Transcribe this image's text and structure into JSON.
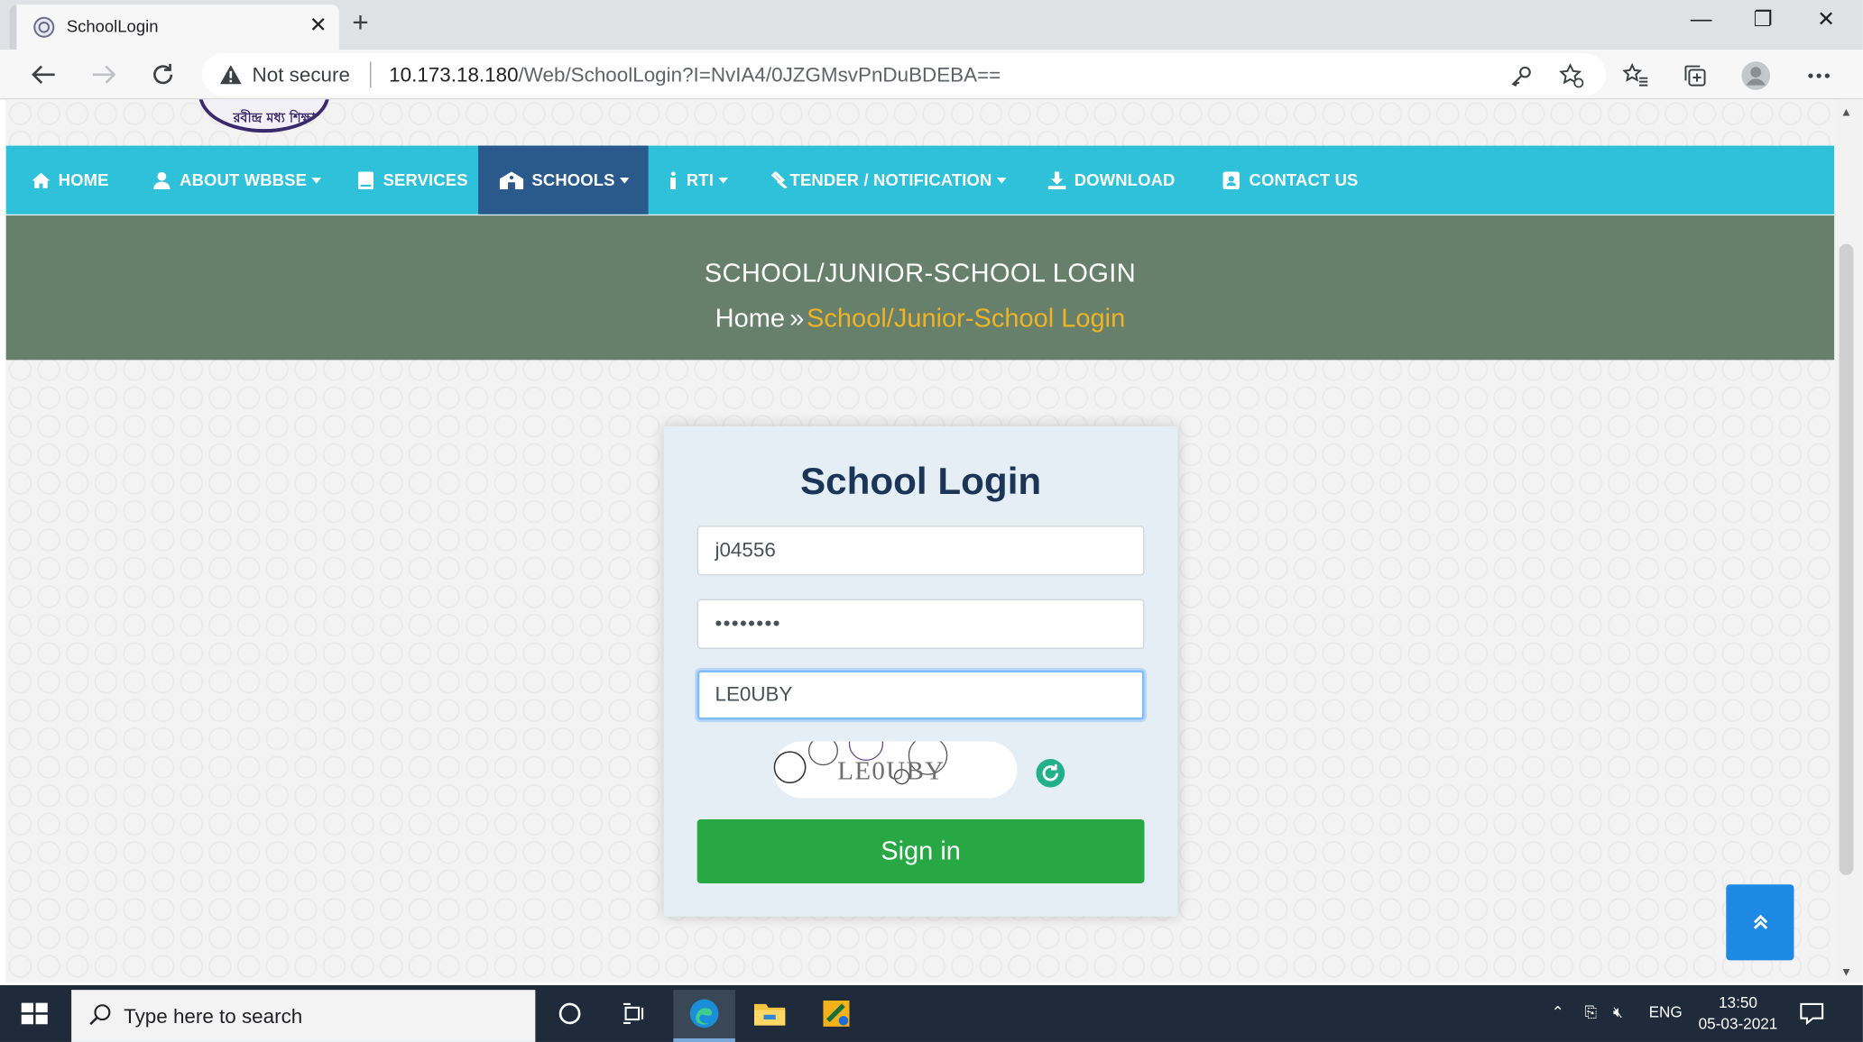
{
  "browser": {
    "tab_title": "SchoolLogin",
    "address": {
      "security_label": "Not secure",
      "url_host": "10.173.18.180",
      "url_path": "/Web/SchoolLogin?I=NvIA4/0JZGMsvPnDuBDEBA=="
    }
  },
  "site": {
    "logo_text": "রবীন্দ্র মধ্য শিক্ষা",
    "nav": [
      {
        "label": "HOME",
        "icon": "home-icon"
      },
      {
        "label": "ABOUT WBBSE",
        "icon": "user-icon",
        "dropdown": true
      },
      {
        "label": "SERVICES",
        "icon": "book-icon"
      },
      {
        "label": "SCHOOLS",
        "icon": "school-icon",
        "dropdown": true,
        "active": true
      },
      {
        "label": "RTI",
        "icon": "info-icon",
        "dropdown": true
      },
      {
        "label": "TENDER / NOTIFICATION",
        "icon": "gavel-icon",
        "dropdown": true
      },
      {
        "label": "DOWNLOAD",
        "icon": "download-icon"
      },
      {
        "label": "CONTACT US",
        "icon": "contact-icon"
      }
    ],
    "banner": {
      "title": "SCHOOL/JUNIOR-SCHOOL LOGIN",
      "breadcrumb_home": "Home",
      "breadcrumb_separator": "»",
      "breadcrumb_current": "School/Junior-School Login"
    }
  },
  "login": {
    "title": "School Login",
    "username_value": "j04556",
    "password_value": "••••••••",
    "captcha_input_value": "LE0UBY",
    "captcha_image_text": "LE0UBY",
    "signin_label": "Sign in"
  },
  "taskbar": {
    "search_placeholder": "Type here to search",
    "language": "ENG",
    "time": "13:50",
    "date": "05-03-2021"
  },
  "colors": {
    "nav_bg": "#2ec1d9",
    "nav_active": "#2a5a8c",
    "banner_bg": "#67806c",
    "breadcrumb_accent": "#f0b323",
    "signin_bg": "#28a745",
    "card_title": "#1b3558"
  }
}
